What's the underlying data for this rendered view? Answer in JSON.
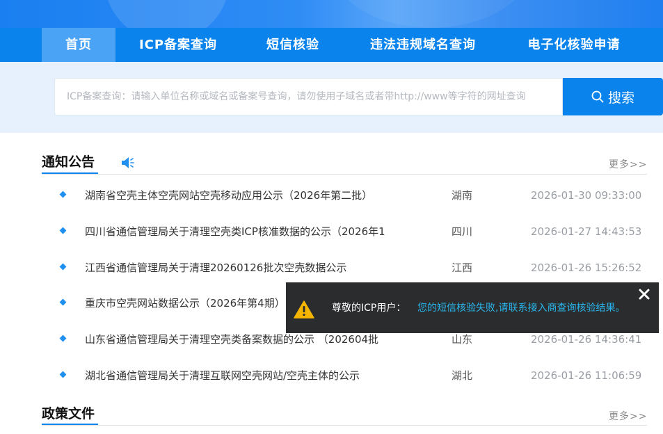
{
  "nav": {
    "items": [
      "首页",
      "ICP备案查询",
      "短信核验",
      "违法违规域名查询",
      "电子化核验申请"
    ],
    "active_index": 0
  },
  "search": {
    "placeholder": "ICP备案查询：请输入单位名称或域名或备案号查询，请勿使用子域名或者带http://www等字符的网址查询",
    "button_label": "搜索"
  },
  "notices": {
    "title": "通知公告",
    "more": "更多>>",
    "items": [
      {
        "title": "湖南省空壳主体空壳网站空壳移动应用公示（2026年第二批）",
        "region": "湖南",
        "date": "2026-01-30 09:33:00"
      },
      {
        "title": "四川省通信管理局关于清理空壳类ICP核准数据的公示（2026年1",
        "region": "四川",
        "date": "2026-01-27 14:43:53"
      },
      {
        "title": "江西省通信管理局关于清理20260126批次空壳数据公示",
        "region": "江西",
        "date": "2026-01-26 15:26:52"
      },
      {
        "title": "重庆市空壳网站数据公示（2026年第4期）",
        "region": "",
        "date": ""
      },
      {
        "title": "山东省通信管理局关于清理空壳类备案数据的公示 （202604批",
        "region": "山东",
        "date": "2026-01-26 14:36:41"
      },
      {
        "title": "湖北省通信管理局关于清理互联网空壳网站/空壳主体的公示",
        "region": "湖北",
        "date": "2026-01-26 11:06:59"
      }
    ]
  },
  "policy": {
    "title": "政策文件",
    "more": "更多>>"
  },
  "toast": {
    "label": "尊敬的ICP用户：",
    "message": "您的短信核验失败,请联系接入商查询核验结果。",
    "icon": "warning-icon"
  },
  "colors": {
    "primary": "#0a84ec",
    "nav_active": "#4aa3f5",
    "toast_bg": "#2b2c2e",
    "toast_link": "#29b6ec",
    "warning": "#f5b400"
  }
}
